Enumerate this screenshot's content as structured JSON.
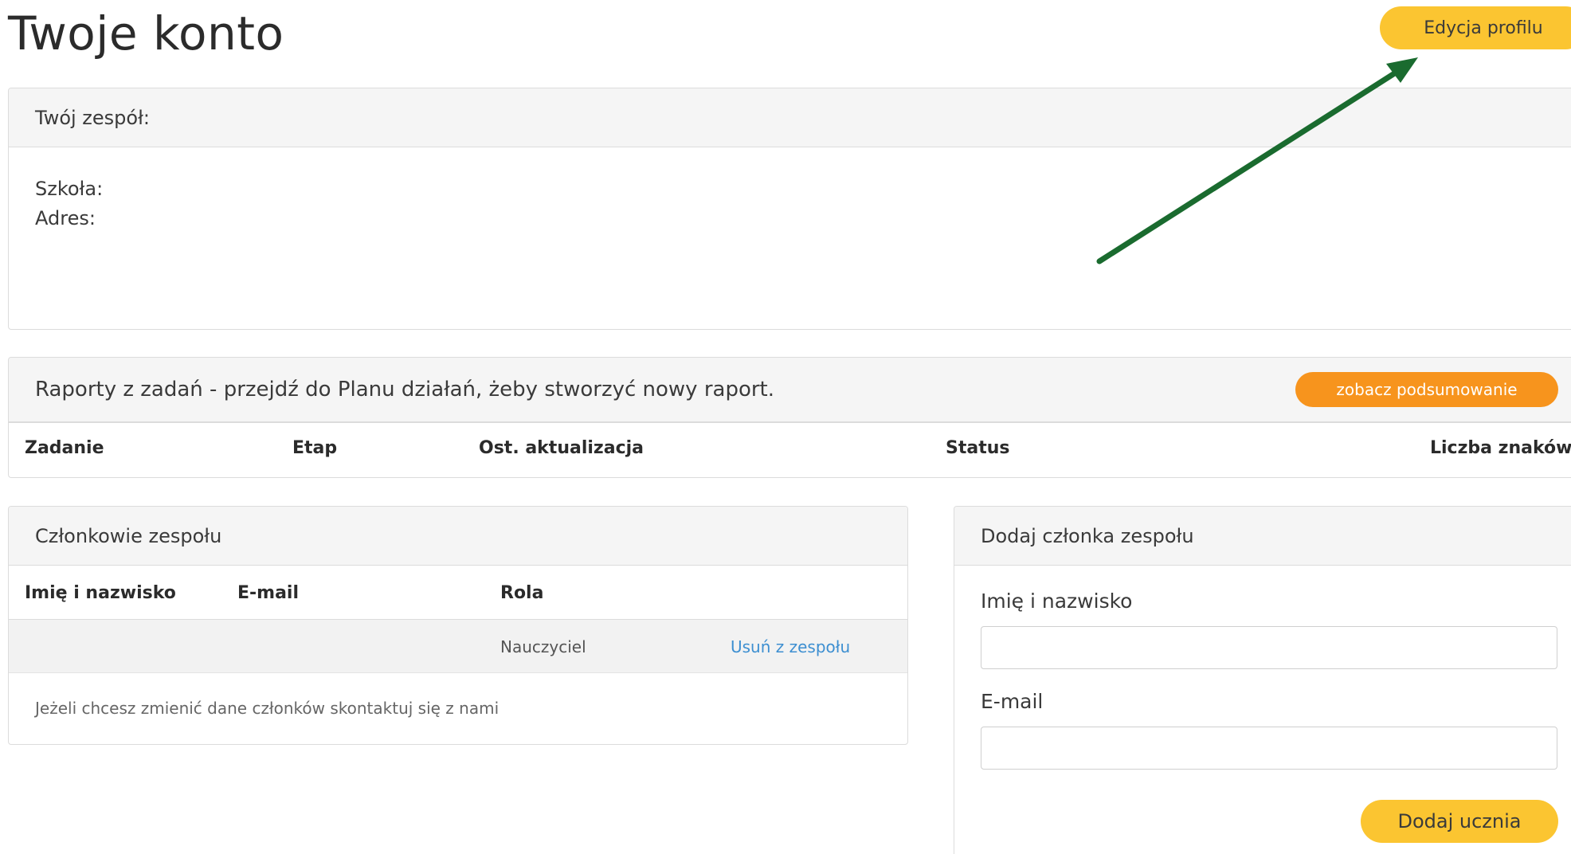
{
  "page": {
    "title": "Twoje konto",
    "edit_profile_label": "Edycja profilu"
  },
  "team": {
    "header": "Twój zespół:",
    "school_label": "Szkoła:",
    "address_label": "Adres:"
  },
  "reports": {
    "header": "Raporty z zadań - przejdź do Planu działań, żeby stworzyć nowy raport.",
    "summary_button": "zobacz podsumowanie",
    "columns": [
      "Zadanie",
      "Etap",
      "Ost. aktualizacja",
      "Status",
      "Liczba znaków"
    ]
  },
  "members": {
    "header": "Członkowie zespołu",
    "columns": [
      "Imię i nazwisko",
      "E-mail",
      "Rola"
    ],
    "rows": [
      {
        "name": "",
        "email": "",
        "role": "Nauczyciel",
        "action": "Usuń z zespołu"
      }
    ],
    "note": "Jeżeli chcesz zmienić dane członków skontaktuj się z nami"
  },
  "add_member": {
    "header": "Dodaj członka zespołu",
    "name_label": "Imię i nazwisko",
    "name_value": "",
    "email_label": "E-mail",
    "email_value": "",
    "submit_label": "Dodaj ucznia"
  },
  "annotation": {
    "arrow_icon": "arrow-annotation-icon",
    "arrow_color": "#1a6b2f"
  },
  "colors": {
    "primary_button": "#fbc531",
    "secondary_button": "#f7941d",
    "link": "#3d8fd1",
    "panel_header_bg": "#f5f5f5"
  }
}
